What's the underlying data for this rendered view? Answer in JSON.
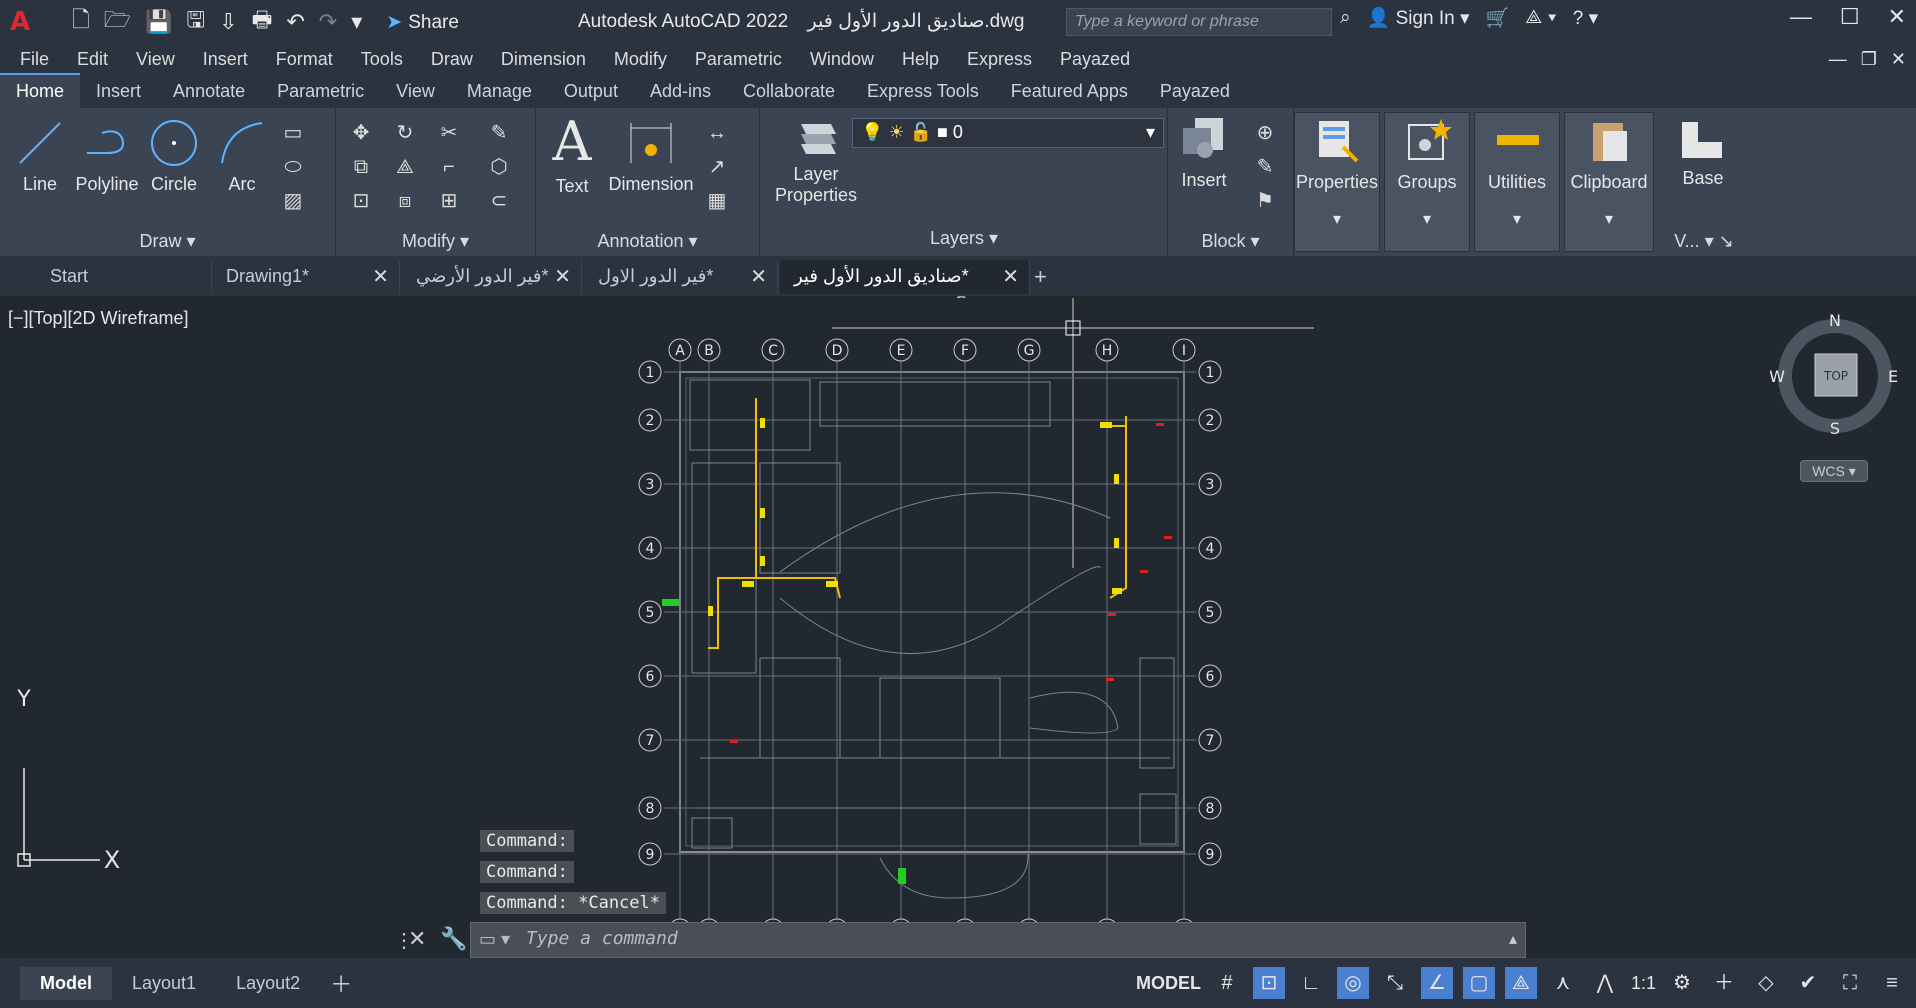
{
  "title_bar": {
    "app_title": "Autodesk AutoCAD 2022",
    "file_name": "صناديق الدور الأول فير.dwg",
    "share_label": "Share",
    "search_placeholder": "Type a keyword or phrase",
    "sign_in": "Sign In"
  },
  "menu": [
    "File",
    "Edit",
    "View",
    "Insert",
    "Format",
    "Tools",
    "Draw",
    "Dimension",
    "Modify",
    "Parametric",
    "Window",
    "Help",
    "Express",
    "Payazed"
  ],
  "ribbon_tabs": [
    "Home",
    "Insert",
    "Annotate",
    "Parametric",
    "View",
    "Manage",
    "Output",
    "Add-ins",
    "Collaborate",
    "Express Tools",
    "Featured Apps",
    "Payazed"
  ],
  "ribbon": {
    "draw": {
      "title": "Draw",
      "line": "Line",
      "polyline": "Polyline",
      "circle": "Circle",
      "arc": "Arc"
    },
    "modify": {
      "title": "Modify"
    },
    "annotation": {
      "title": "Annotation",
      "text": "Text",
      "dimension": "Dimension"
    },
    "layers": {
      "title": "Layers",
      "layer_properties_1": "Layer",
      "layer_properties_2": "Properties",
      "current_layer": "0"
    },
    "block": {
      "title": "Block",
      "insert": "Insert"
    },
    "properties": "Properties",
    "groups": "Groups",
    "utilities": "Utilities",
    "clipboard": "Clipboard",
    "base": "Base",
    "view_short": "V..."
  },
  "doc_tabs": [
    {
      "label": "Start",
      "closable": false
    },
    {
      "label": "Drawing1*",
      "closable": true
    },
    {
      "label": "فير الدور الأرضي*",
      "closable": true
    },
    {
      "label": "فير الدور الاول*",
      "closable": true
    },
    {
      "label": "صناديق الدور الأول فير*",
      "closable": true,
      "active": true
    }
  ],
  "viewport": {
    "label": "[−][Top][2D Wireframe]",
    "viewcube_top": "TOP",
    "compass": {
      "n": "N",
      "s": "S",
      "e": "E",
      "w": "W"
    },
    "wcs": "WCS",
    "grid_cols": [
      "A",
      "B",
      "C",
      "D",
      "E",
      "F",
      "G",
      "H",
      "I"
    ],
    "grid_rows": [
      "1",
      "2",
      "3",
      "4",
      "5",
      "6",
      "7",
      "8",
      "9"
    ]
  },
  "command": {
    "history": [
      "Command:",
      "Command:",
      "Command: *Cancel*"
    ],
    "placeholder": "Type a command"
  },
  "status": {
    "layout_tabs": [
      "Model",
      "Layout1",
      "Layout2"
    ],
    "model_label": "MODEL",
    "scale": "1:1"
  }
}
